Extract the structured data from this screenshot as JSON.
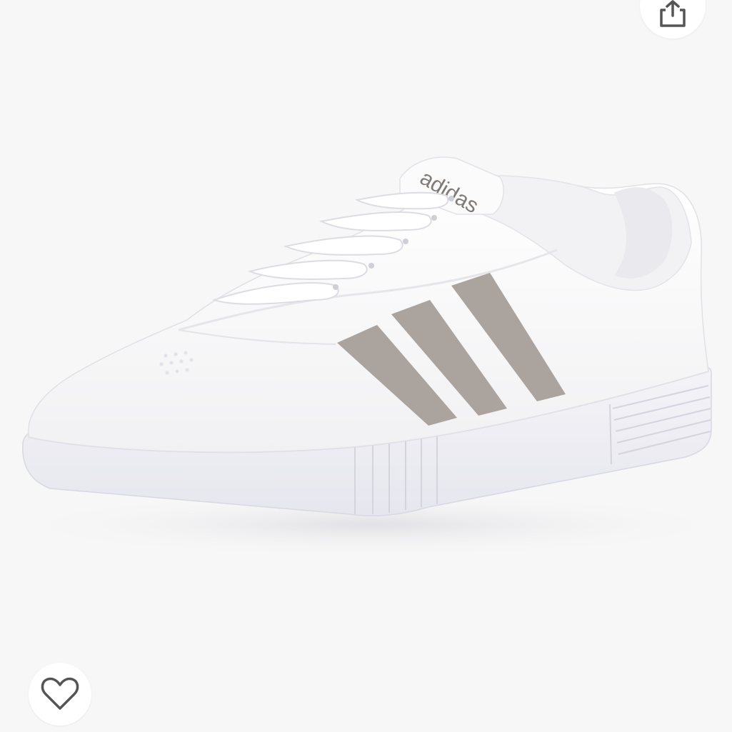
{
  "product_image": {
    "brand_logo_text": "adidas",
    "colors": {
      "background": "#f7f7f7",
      "shoe_upper": "#ffffff",
      "stripes": "#aaa39e",
      "sole": "#f1f1f6",
      "icon": "#555555"
    }
  },
  "actions": {
    "share_icon": "share-icon",
    "wishlist_icon": "heart-outline-icon"
  }
}
